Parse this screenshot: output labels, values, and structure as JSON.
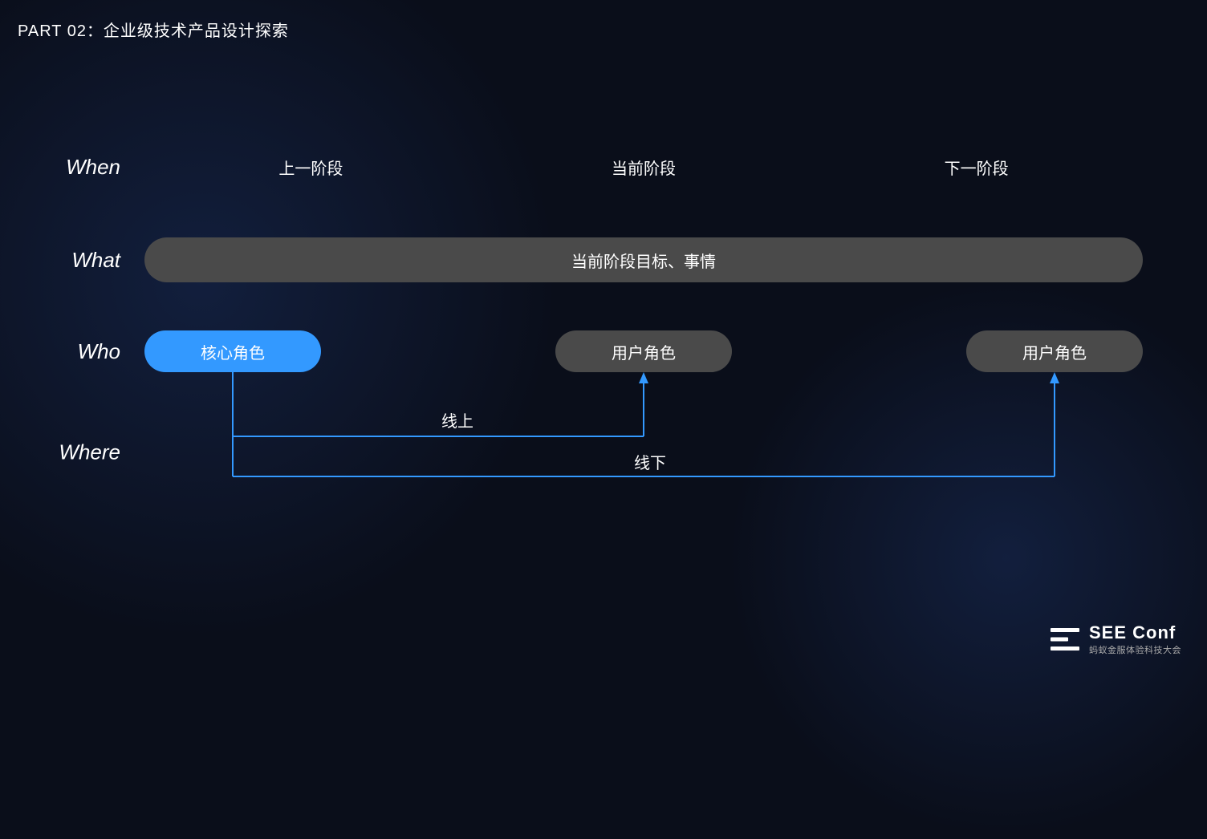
{
  "slide": {
    "part_label": "PART 02：企业级技术产品设计探索",
    "when_row": {
      "label": "When",
      "items": [
        {
          "text": "上一阶段",
          "type": "gray-first"
        },
        {
          "text": "当前阶段",
          "type": "blue"
        },
        {
          "text": "下一阶段",
          "type": "dark-last"
        }
      ]
    },
    "what_row": {
      "label": "What",
      "content": "当前阶段目标、事情"
    },
    "who_row": {
      "label": "Who",
      "pills": [
        {
          "text": "核心角色",
          "type": "blue"
        },
        {
          "text": "用户角色",
          "type": "gray"
        },
        {
          "text": "用户角色",
          "type": "gray"
        }
      ]
    },
    "where_row": {
      "label": "Where",
      "connectors": [
        {
          "text": "线上",
          "type": "online"
        },
        {
          "text": "线下",
          "type": "offline"
        }
      ]
    },
    "logo": {
      "main": "SEE Conf",
      "sub": "蚂蚁金服体验科技大会"
    }
  }
}
